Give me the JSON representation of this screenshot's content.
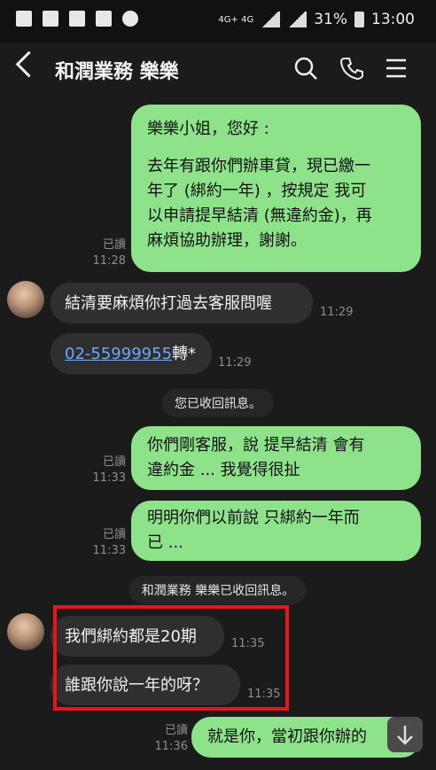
{
  "statusbar": {
    "network": "4G+ 4G",
    "battery_percent": "31%",
    "time": "13:00"
  },
  "header": {
    "title": "和潤業務 樂樂"
  },
  "messages": {
    "m1": {
      "text_l1": "樂樂小姐，您好 :",
      "text_l2": "去年有跟你們辦車貸，現已繳一",
      "text_l3": "年了 (綁約一年) ，按規定 我可",
      "text_l4": "以申請提早結清 (無違約金)，再",
      "text_l5": "麻煩協助辦理，謝謝。",
      "read": "已讀",
      "time": "11:28"
    },
    "m2": {
      "text": "結清要麻煩你打過去客服問喔",
      "time": "11:29"
    },
    "m3": {
      "phone": "02-55999955",
      "suffix": "轉*",
      "time": "11:29"
    },
    "sys1": "您已收回訊息。",
    "m4": {
      "text_l1": "你們剛客服，說 提早結清 會有",
      "text_l2": "違約金 ... 我覺得很扯",
      "read": "已讀",
      "time": "11:33"
    },
    "m5": {
      "text_l1": "明明你們以前說 只綁約一年而",
      "text_l2": "已 ...",
      "read": "已讀",
      "time": "11:33"
    },
    "sys2": "和潤業務 樂樂已收回訊息。",
    "m6": {
      "text": "我們綁約都是20期",
      "time": "11:35"
    },
    "m7": {
      "text": "誰跟你說一年的呀？",
      "time": "11:35"
    },
    "m8": {
      "text": "就是你，當初跟你辦的",
      "read": "已讀",
      "time": "11:36"
    }
  },
  "icons": [
    "back-arrow-icon",
    "search-icon",
    "phone-icon",
    "menu-icon",
    "scroll-down-icon"
  ]
}
